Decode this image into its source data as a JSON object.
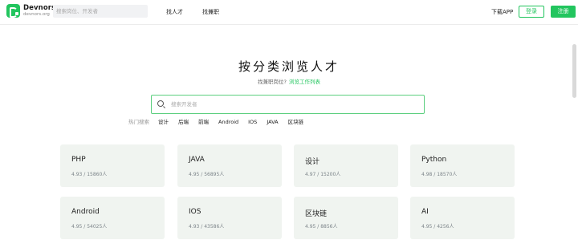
{
  "header": {
    "logo_name": "Devnors",
    "logo_domain": "devnors.org",
    "search_placeholder": "搜索岗位、开发者",
    "nav": [
      "找人才",
      "找兼职"
    ],
    "download": "下载APP",
    "login": "登录",
    "register": "注册"
  },
  "hero": {
    "title": "按分类浏览人才",
    "subtitle": "找兼职岗位?",
    "subtitle_link": "浏览工作列表"
  },
  "search": {
    "placeholder": "搜索开发者"
  },
  "hot": {
    "label": "热门搜索",
    "tags": [
      "设计",
      "后端",
      "前端",
      "Android",
      "IOS",
      "JAVA",
      "区块链"
    ]
  },
  "categories": [
    {
      "name": "PHP",
      "rating": "4.93",
      "count": "15860人"
    },
    {
      "name": "JAVA",
      "rating": "4.95",
      "count": "56895人"
    },
    {
      "name": "设计",
      "rating": "4.97",
      "count": "15200人"
    },
    {
      "name": "Python",
      "rating": "4.98",
      "count": "18570人"
    },
    {
      "name": "Android",
      "rating": "4.95",
      "count": "54025人"
    },
    {
      "name": "IOS",
      "rating": "4.93",
      "count": "43586人"
    },
    {
      "name": "区块链",
      "rating": "4.95",
      "count": "8856人"
    },
    {
      "name": "AI",
      "rating": "4.95",
      "count": "4256人"
    }
  ],
  "colors": {
    "accent": "#22c55e",
    "card_bg": "#f0f4f0"
  }
}
